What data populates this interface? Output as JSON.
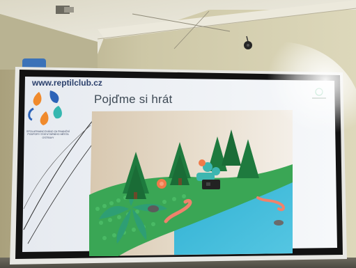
{
  "slide": {
    "site_url": "www.reptilclub.cz",
    "title": "Pojďme si hrát",
    "tagline": "SPOLUFINANCOVÁNO ZA FINANČNÍ PODPORY statutárního MĚSTA OSTRAVY"
  },
  "colors": {
    "wall": "#d8d3b4",
    "ceiling": "#efeee4",
    "bezel": "#111111",
    "slide_bg": "#f4f6f8",
    "logo_orange": "#f08a2c",
    "logo_blue": "#2c63b8",
    "logo_teal": "#36b7b0",
    "lego_green": "#3aa655",
    "lego_water": "#38b7d0",
    "lego_tree": "#1e7a3e",
    "lego_worm": "#f0826c"
  }
}
